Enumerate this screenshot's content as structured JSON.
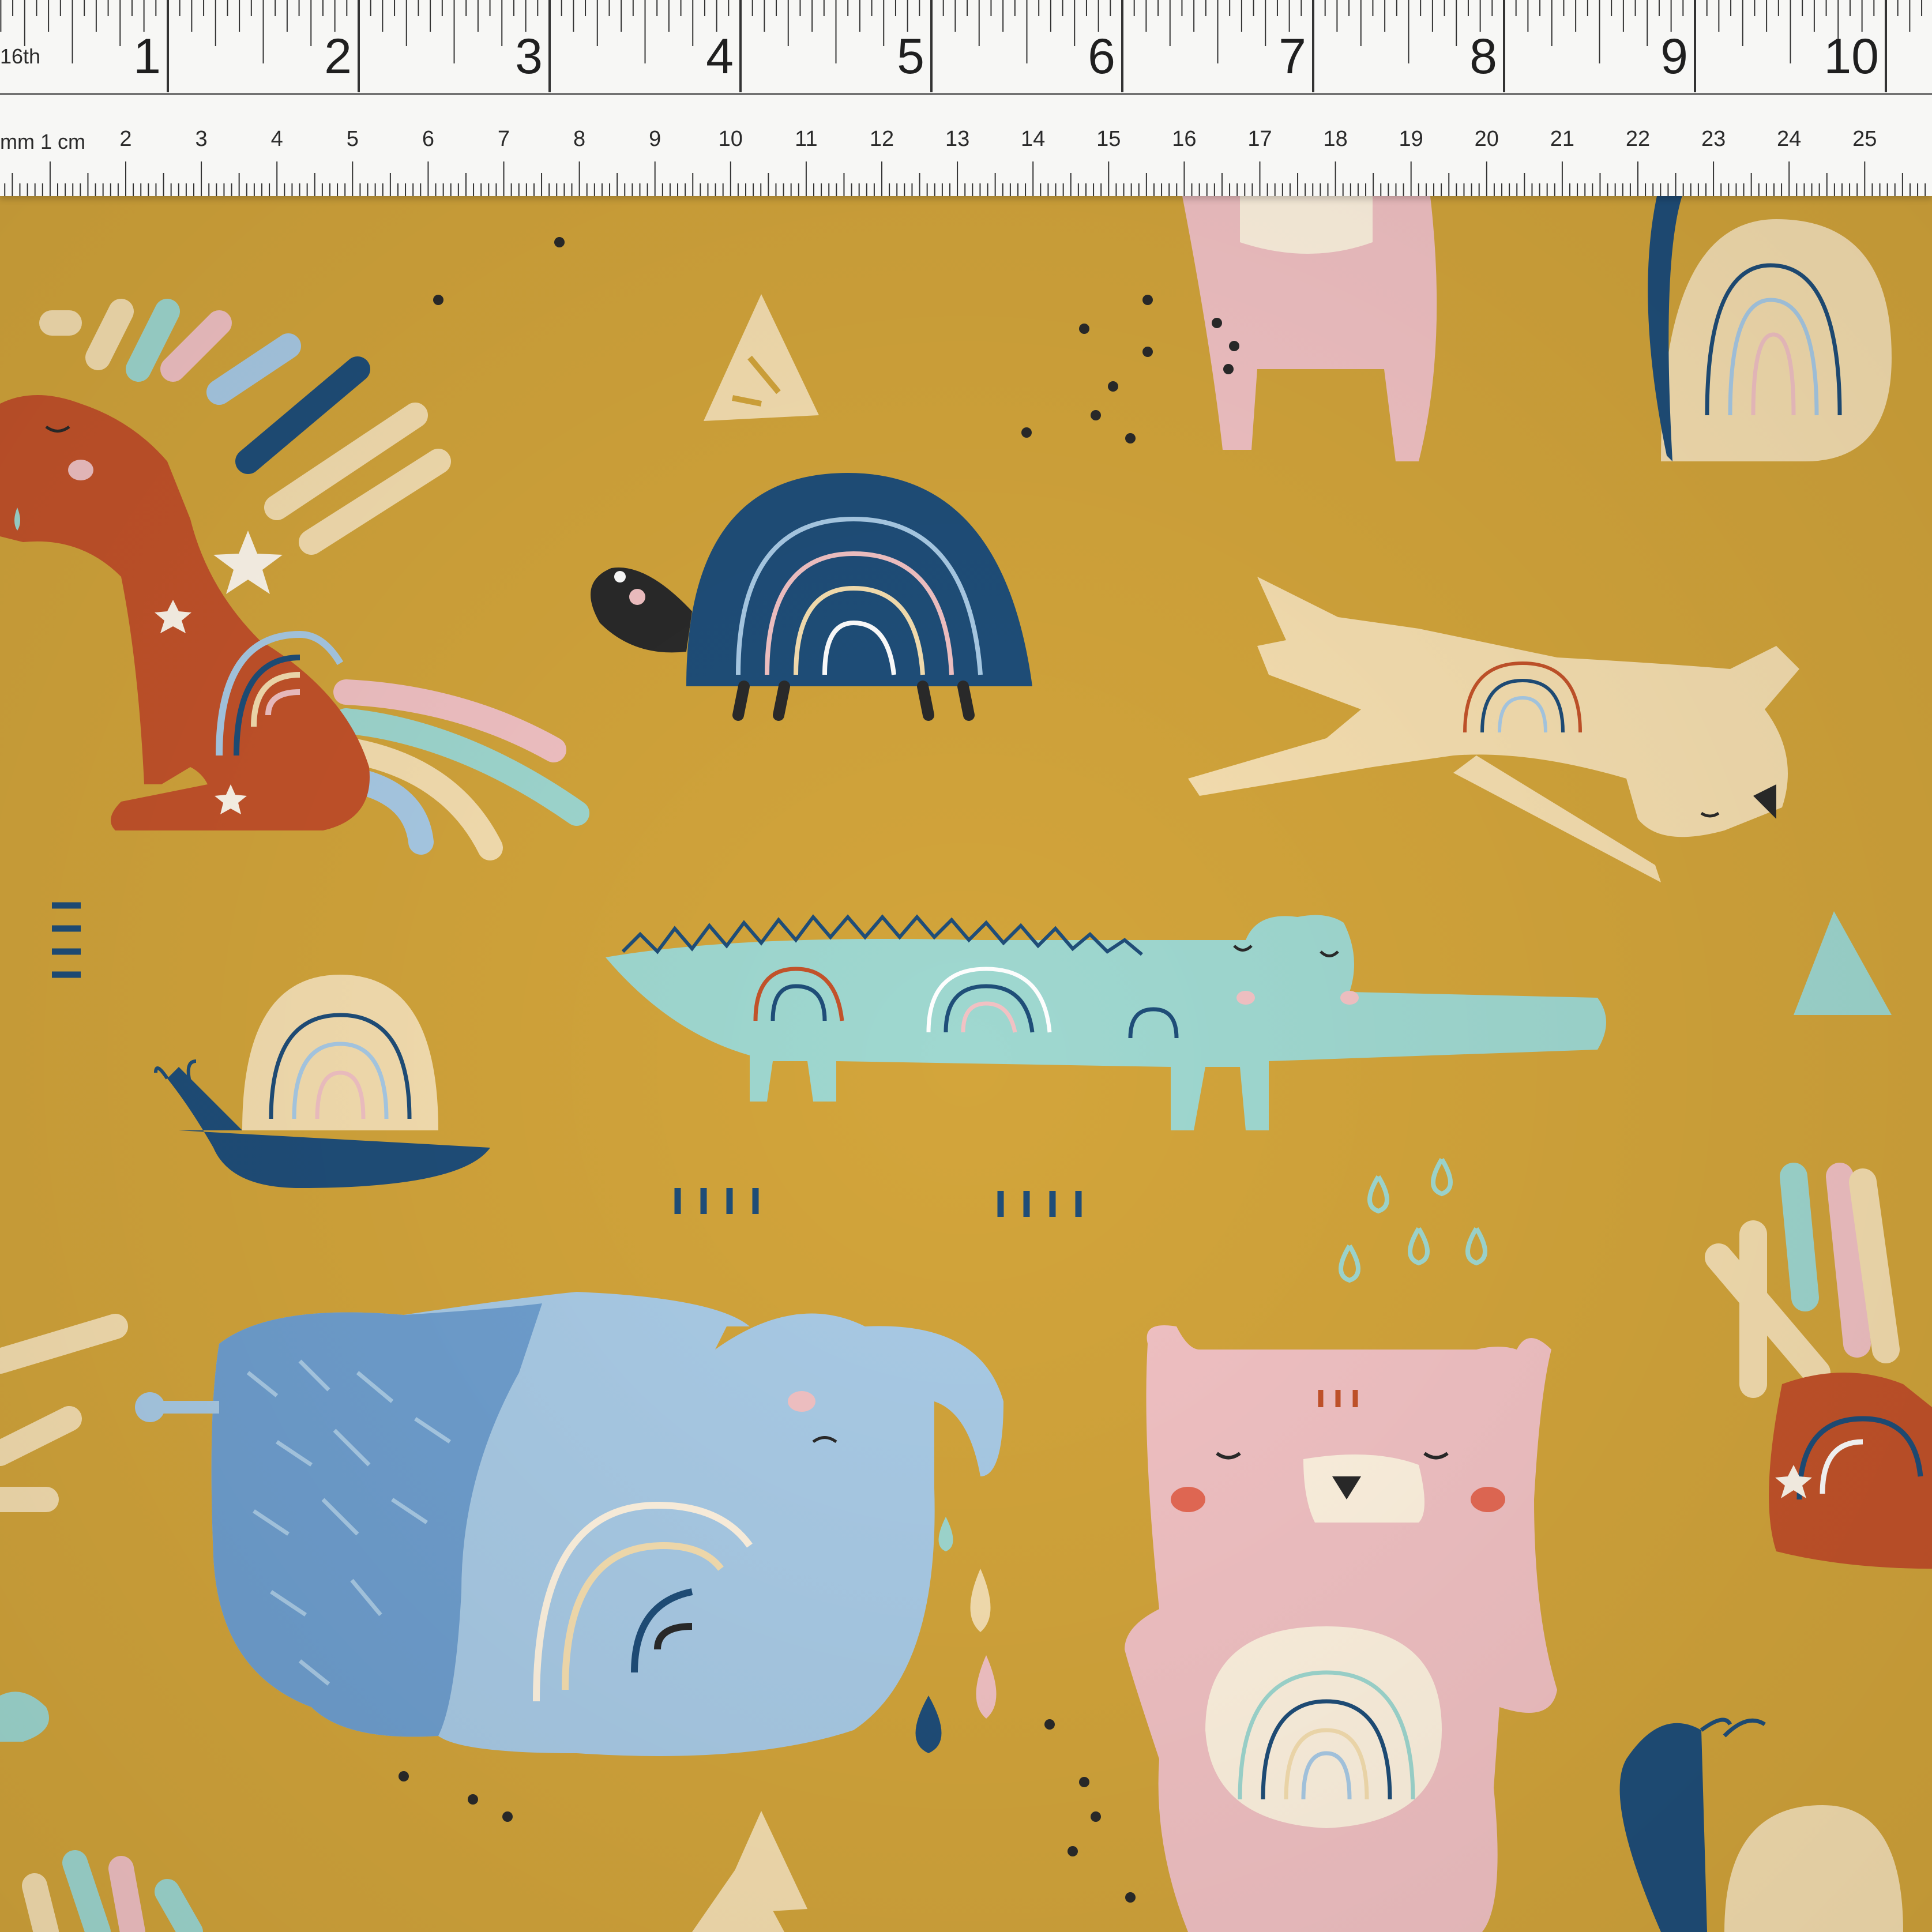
{
  "scene": "printed cotton fabric with rainbow animal motifs beside a measuring ruler",
  "colors": {
    "fabric_background": "#d3a53b",
    "navy": "#1f4e79",
    "rust": "#c4532a",
    "pink": "#f2c2c4",
    "mint": "#9fd8d0",
    "cream": "#f6dfb0",
    "sky_blue": "#a9cbe6",
    "ruler": "#f7f7f5"
  },
  "ruler": {
    "unit_label_top": "16th",
    "inch_marks": [
      "1",
      "2",
      "3",
      "4",
      "5",
      "6",
      "7",
      "8",
      "9",
      "10"
    ],
    "unit_label_bottom": "mm 1 cm",
    "cm_marks": [
      "2",
      "3",
      "4",
      "5",
      "6",
      "7",
      "8",
      "9",
      "10",
      "11",
      "12",
      "13",
      "14",
      "15",
      "16",
      "17",
      "18",
      "19",
      "20",
      "21",
      "22",
      "23",
      "24",
      "25",
      "2"
    ]
  },
  "motifs": [
    "horse-icon",
    "turtle-icon",
    "dog-icon",
    "crocodile-icon",
    "snail-icon",
    "elephant-icon",
    "bear-icon",
    "rabbit-icon",
    "triangle-icon",
    "raindrop-icon",
    "rainbow-icon"
  ]
}
